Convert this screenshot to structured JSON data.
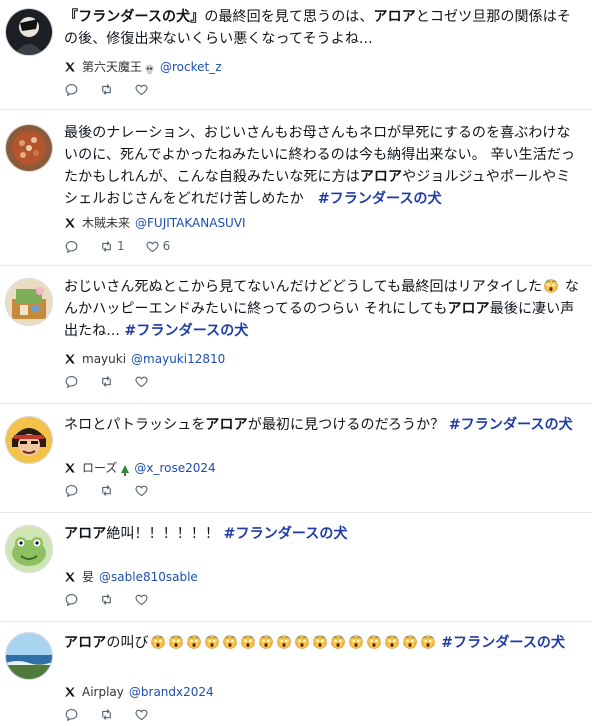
{
  "posts": [
    {
      "text_parts": [
        {
          "t": "『フランダースの犬』",
          "style": "bold"
        },
        {
          "t": "の最終回を見て思うのは、",
          "style": "normal"
        },
        {
          "t": "アロア",
          "style": "bold"
        },
        {
          "t": "とコゼツ旦那の関係はその後、修復出来ないくらい悪くなってそうよね...",
          "style": "normal"
        }
      ],
      "author": "第六天魔王",
      "author_badge": "skull-emoji",
      "handle": "@rocket_z",
      "reposts": "",
      "likes": ""
    },
    {
      "text_parts": [
        {
          "t": "最後のナレーション、おじいさんもお母さんもネロが早死にするのを喜ぶわけないのに、死んでよかったねみたいに終わるのは今も納得出来ない。 辛い生活だったかもしれんが、こんな自殺みたいな死に方は",
          "style": "normal"
        },
        {
          "t": "アロア",
          "style": "bold"
        },
        {
          "t": "やジョルジュやポールやミシェルおじさんをどれだけ苦しめたか　",
          "style": "normal"
        },
        {
          "t": "#フランダースの犬",
          "style": "hashtag"
        }
      ],
      "author": "木賊未来",
      "author_badge": "",
      "handle": "@FUJITAKANASUVI",
      "reposts": "1",
      "likes": "6"
    },
    {
      "text_parts": [
        {
          "t": "おじいさん死ぬとこから見てないんだけどどうしても最終回はリアタイした",
          "style": "normal"
        },
        {
          "t": "",
          "style": "emoji"
        },
        {
          "t": " なんかハッピーエンドみたいに終ってるのつらい それにしても",
          "style": "normal"
        },
        {
          "t": "アロア",
          "style": "bold"
        },
        {
          "t": "最後に凄い声出たね... ",
          "style": "normal"
        },
        {
          "t": "#フランダースの犬",
          "style": "hashtag"
        }
      ],
      "author": "mayuki",
      "author_badge": "",
      "handle": "@mayuki12810",
      "reposts": "",
      "likes": ""
    },
    {
      "text_parts": [
        {
          "t": "ネロとパトラッシュを",
          "style": "normal"
        },
        {
          "t": "アロア",
          "style": "bold"
        },
        {
          "t": "が最初に見つけるのだろうか？ ",
          "style": "normal"
        },
        {
          "t": "#フランダースの犬",
          "style": "hashtag"
        }
      ],
      "author": "ローズ",
      "author_badge": "tree-emoji",
      "handle": "@x_rose2024",
      "reposts": "",
      "likes": ""
    },
    {
      "text_parts": [
        {
          "t": "アロア",
          "style": "bold"
        },
        {
          "t": "絶叫！！！！！！ ",
          "style": "normal"
        },
        {
          "t": "#フランダースの犬",
          "style": "hashtag"
        }
      ],
      "author": "妟",
      "author_badge": "",
      "handle": "@sable810sable",
      "reposts": "",
      "likes": ""
    },
    {
      "text_parts": [
        {
          "t": "アロア",
          "style": "bold"
        },
        {
          "t": "の叫び",
          "style": "normal"
        },
        {
          "t": "",
          "style": "emoji"
        },
        {
          "t": "",
          "style": "emoji"
        },
        {
          "t": "",
          "style": "emoji"
        },
        {
          "t": "",
          "style": "emoji"
        },
        {
          "t": "",
          "style": "emoji"
        },
        {
          "t": "",
          "style": "emoji"
        },
        {
          "t": "",
          "style": "emoji"
        },
        {
          "t": "",
          "style": "emoji"
        },
        {
          "t": "",
          "style": "emoji"
        },
        {
          "t": "",
          "style": "emoji"
        },
        {
          "t": "",
          "style": "emoji"
        },
        {
          "t": "",
          "style": "emoji"
        },
        {
          "t": "",
          "style": "emoji"
        },
        {
          "t": "",
          "style": "emoji"
        },
        {
          "t": "",
          "style": "emoji"
        },
        {
          "t": "",
          "style": "emoji"
        },
        {
          "t": " ",
          "style": "normal"
        },
        {
          "t": "#フランダースの犬",
          "style": "hashtag"
        }
      ],
      "author": "Airplay",
      "author_badge": "",
      "handle": "@brandx2024",
      "reposts": "",
      "likes": ""
    }
  ],
  "icons": {
    "platform": "x-logo-icon",
    "reply": "reply-icon",
    "repost": "repost-icon",
    "like": "heart-icon"
  },
  "colors": {
    "hashtag": "#1f3aa8",
    "handle": "#1d4fae",
    "divider": "#e6e9ec"
  }
}
